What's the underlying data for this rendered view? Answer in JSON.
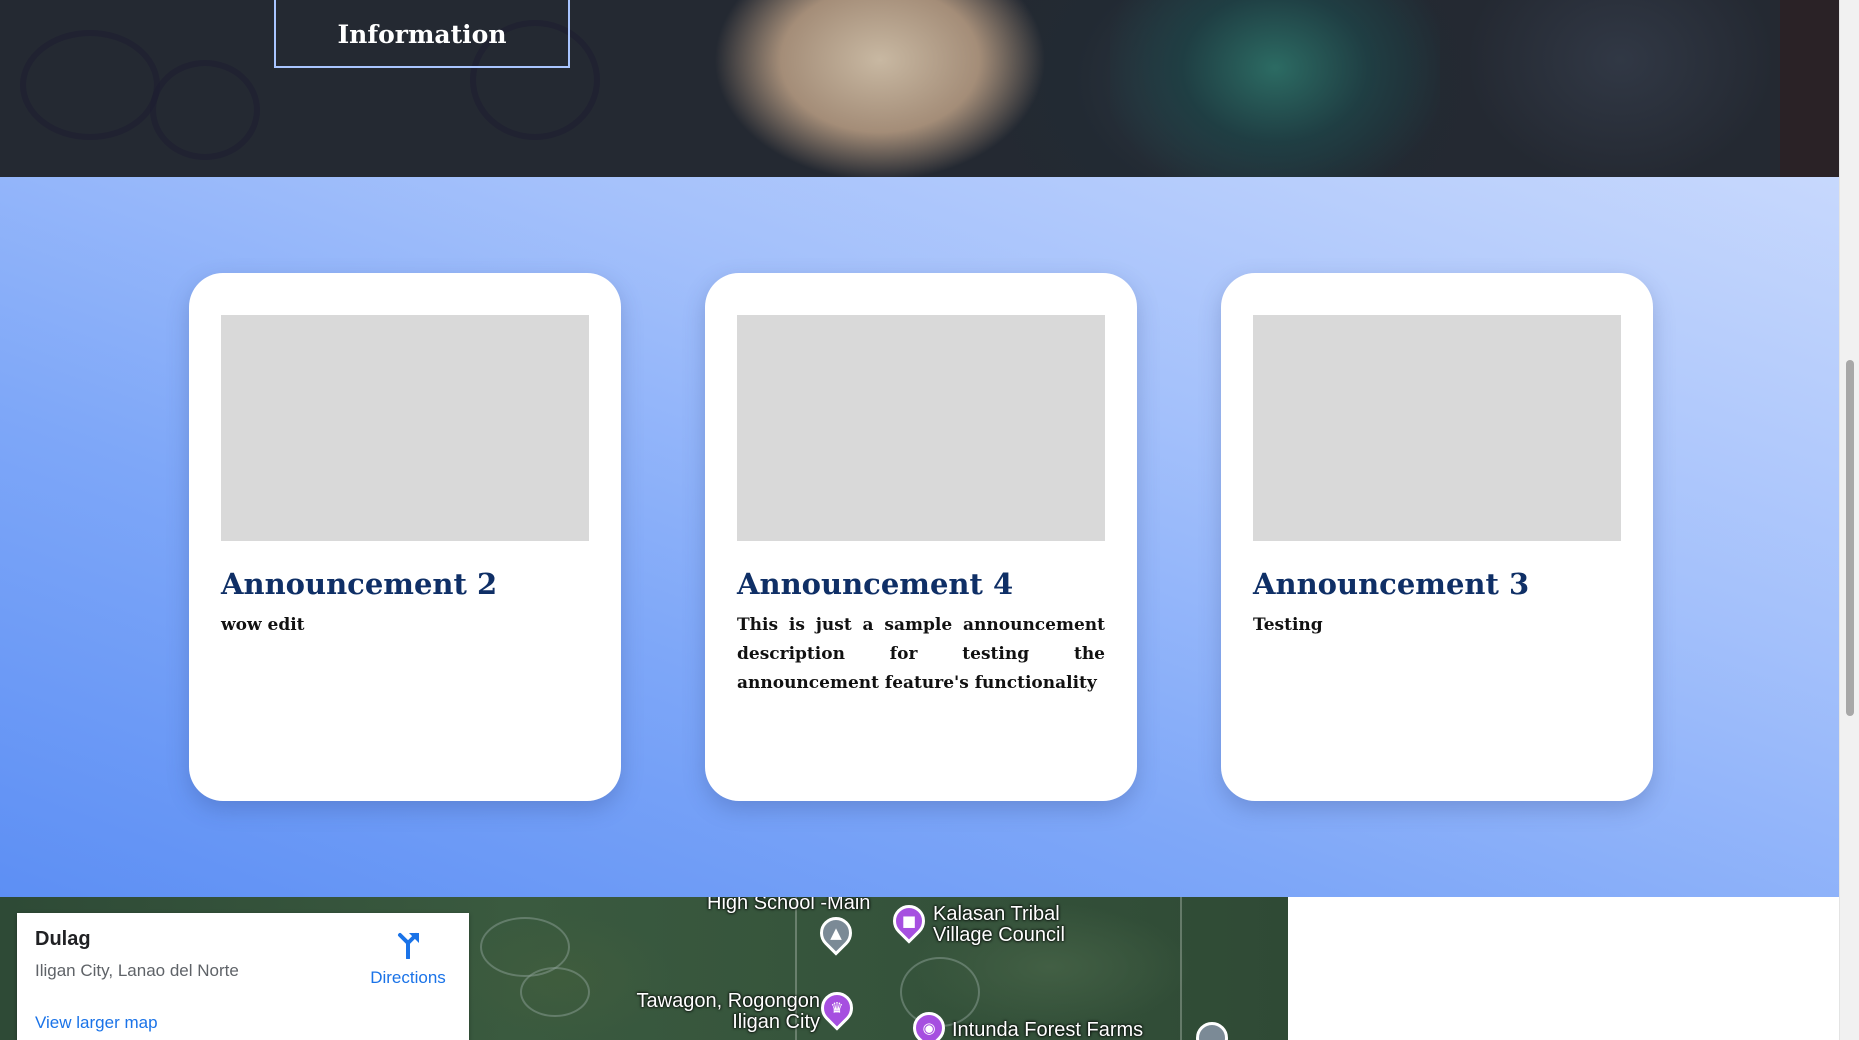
{
  "hero": {
    "button_label": "Information"
  },
  "announcements": [
    {
      "title": "Announcement 2",
      "description": "wow edit"
    },
    {
      "title": "Announcement 4",
      "description": "This is just a sample announcement description for testing the announcement feature's functionality"
    },
    {
      "title": "Announcement 3",
      "description": "Testing"
    }
  ],
  "map": {
    "place_name": "Dulag",
    "address": "Iligan City, Lanao del Norte",
    "directions_label": "Directions",
    "larger_map_label": "View larger map",
    "pois": [
      {
        "label": "High School -Main",
        "icon": "school-icon"
      },
      {
        "label": "Kalasan Tribal Village Council",
        "icon": "building-icon"
      },
      {
        "label": "Tawagon, Rogongon Iligan City",
        "icon": "landmark-icon"
      },
      {
        "label": "Intunda Forest Farms",
        "icon": "camera-icon"
      }
    ]
  },
  "colors": {
    "title_navy": "#0f2f66",
    "section_gradient_start": "#5d8ff4",
    "section_gradient_end": "#c7d8fd",
    "map_link_blue": "#1a73e8",
    "poi_purple": "#a64fe0",
    "poi_gray": "#7b8a96"
  }
}
